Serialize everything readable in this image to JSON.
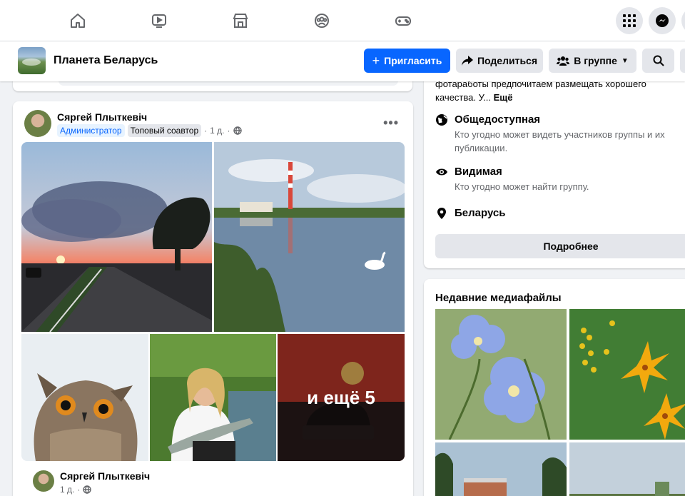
{
  "nav": {
    "tabs": [
      "home-icon",
      "video-icon",
      "marketplace-icon",
      "groups-icon",
      "gaming-icon"
    ],
    "right": [
      "menu-grid-icon",
      "messenger-icon"
    ]
  },
  "group": {
    "name": "Планета Беларусь",
    "invite_label": "Пригласить",
    "share_label": "Поделиться",
    "member_label": "В группе",
    "search_icon": "search-icon"
  },
  "post": {
    "author": "Сяргей Плыткевіч",
    "role_badge": "Администратор",
    "top_badge": "Топовый соавтор",
    "time": "1 д.",
    "more_photos": "и ещё 5",
    "comment_author": "Сяргей Плыткевіч",
    "comment_time": "1 д."
  },
  "about": {
    "truncated_text_1": "фотаработы предпочитаем размещать хорошего",
    "truncated_text_2": "качества. У...",
    "see_more": "Ещё",
    "public_title": "Общедоступная",
    "public_desc": "Кто угодно может видеть участников группы и их публикации.",
    "visible_title": "Видимая",
    "visible_desc": "Кто угодно может найти группу.",
    "location": "Беларусь",
    "details_button": "Подробнее"
  },
  "media": {
    "title": "Недавние медиафайлы"
  },
  "colors": {
    "accent": "#0866ff",
    "background": "#f0f2f5"
  }
}
